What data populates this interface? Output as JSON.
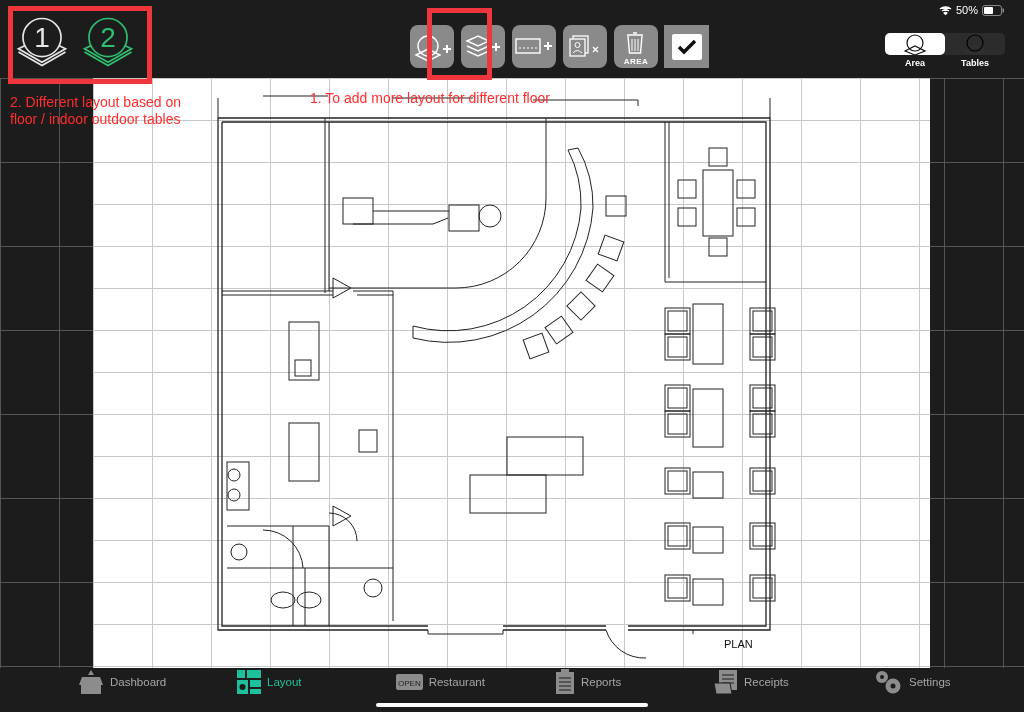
{
  "status_bar": {
    "battery": "50%"
  },
  "floors": [
    {
      "label": "1",
      "selected": false
    },
    {
      "label": "2",
      "selected": true
    }
  ],
  "toolbar": {
    "buttons": [
      {
        "kind": "add-area"
      },
      {
        "kind": "add-floor"
      },
      {
        "kind": "add-wall"
      },
      {
        "kind": "remove-photo"
      },
      {
        "kind": "delete-area",
        "label": "AREA"
      }
    ],
    "confirm": {
      "checked": true
    }
  },
  "view_switch": [
    {
      "label": "Area",
      "selected": true
    },
    {
      "label": "Tables",
      "selected": false
    }
  ],
  "annotations": [
    {
      "kind": "floors",
      "text": "2. Different layout based on\nfloor / indoor outdoor tables"
    },
    {
      "kind": "toolbar",
      "text": "1. To add more layout for different floor"
    }
  ],
  "plan": {
    "label": "PLAN"
  },
  "tabs": [
    {
      "kind": "dashboard",
      "label": "Dashboard",
      "selected": false
    },
    {
      "kind": "layout",
      "label": "Layout",
      "selected": true
    },
    {
      "kind": "restaurant",
      "label": "Restaurant",
      "icon_text": "OPEN",
      "selected": false
    },
    {
      "kind": "reports",
      "label": "Reports",
      "selected": false
    },
    {
      "kind": "receipts",
      "label": "Receipts",
      "selected": false
    },
    {
      "kind": "settings",
      "label": "Settings",
      "selected": false
    }
  ]
}
